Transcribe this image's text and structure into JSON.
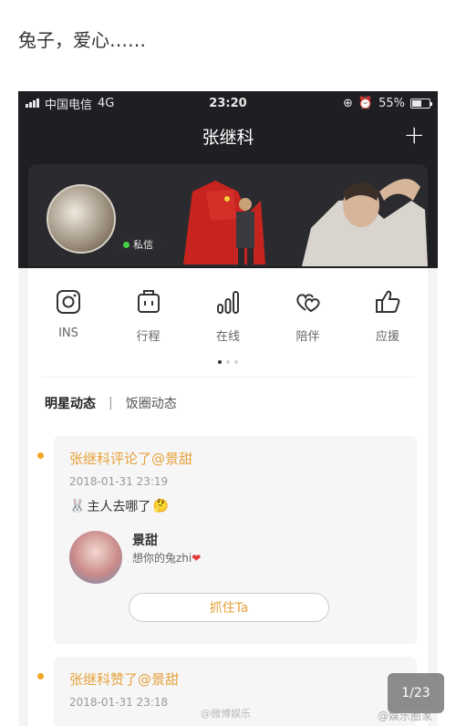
{
  "caption": "兔子，爱心……",
  "statusbar": {
    "carrier": "中国电信",
    "network": "4G",
    "time": "23:20",
    "battery": "55%",
    "battery_level": 0.55
  },
  "header": {
    "title": "张继科",
    "plus": "+"
  },
  "banner": {
    "message_label": "私信"
  },
  "icons": [
    {
      "label": "INS",
      "icon": "instagram-icon"
    },
    {
      "label": "行程",
      "icon": "calendar-icon"
    },
    {
      "label": "在线",
      "icon": "signal-bars-icon"
    },
    {
      "label": "陪伴",
      "icon": "hearts-icon"
    },
    {
      "label": "应援",
      "icon": "thumbs-up-icon"
    }
  ],
  "tabs": {
    "active": "明星动态",
    "separator": "|",
    "inactive": "饭圈动态"
  },
  "feed": [
    {
      "title": "张继科评论了@景甜",
      "time": "2018-01-31 23:19",
      "text": "主人去哪了",
      "user": "景甜",
      "user_message": "想你的兔zhi",
      "button": "抓住Ta"
    },
    {
      "title": "张继科赞了@景甜",
      "time": "2018-01-31 23:18"
    }
  ],
  "page_badge": "1/23",
  "watermark_center": "@微博娱乐",
  "watermark_right": "@娱乐圈家",
  "colors": {
    "accent": "#e6a23c",
    "dark": "#1f1f23",
    "online": "#46d04a"
  }
}
